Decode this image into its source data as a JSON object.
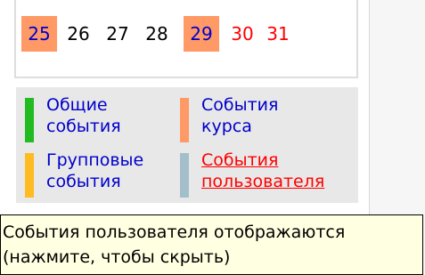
{
  "calendar": {
    "days": [
      {
        "label": "25",
        "kind": "course"
      },
      {
        "label": "26",
        "kind": "normal"
      },
      {
        "label": "27",
        "kind": "normal"
      },
      {
        "label": "28",
        "kind": "normal"
      },
      {
        "label": "29",
        "kind": "course"
      },
      {
        "label": "30",
        "kind": "weekend"
      },
      {
        "label": "31",
        "kind": "weekend"
      }
    ]
  },
  "legend": {
    "items": [
      {
        "label": "Общие\nсобытия",
        "color": "#22bb22"
      },
      {
        "label": "События\nкурса",
        "color": "#ff9966"
      },
      {
        "label": "Групповые\nсобытия",
        "color": "#ffbb22"
      },
      {
        "label": "События\nпользователя",
        "color": "#a3bfcc"
      }
    ]
  },
  "tooltip": {
    "line1": "События пользователя отображаются",
    "line2": "(нажмите, чтобы скрыть)"
  }
}
